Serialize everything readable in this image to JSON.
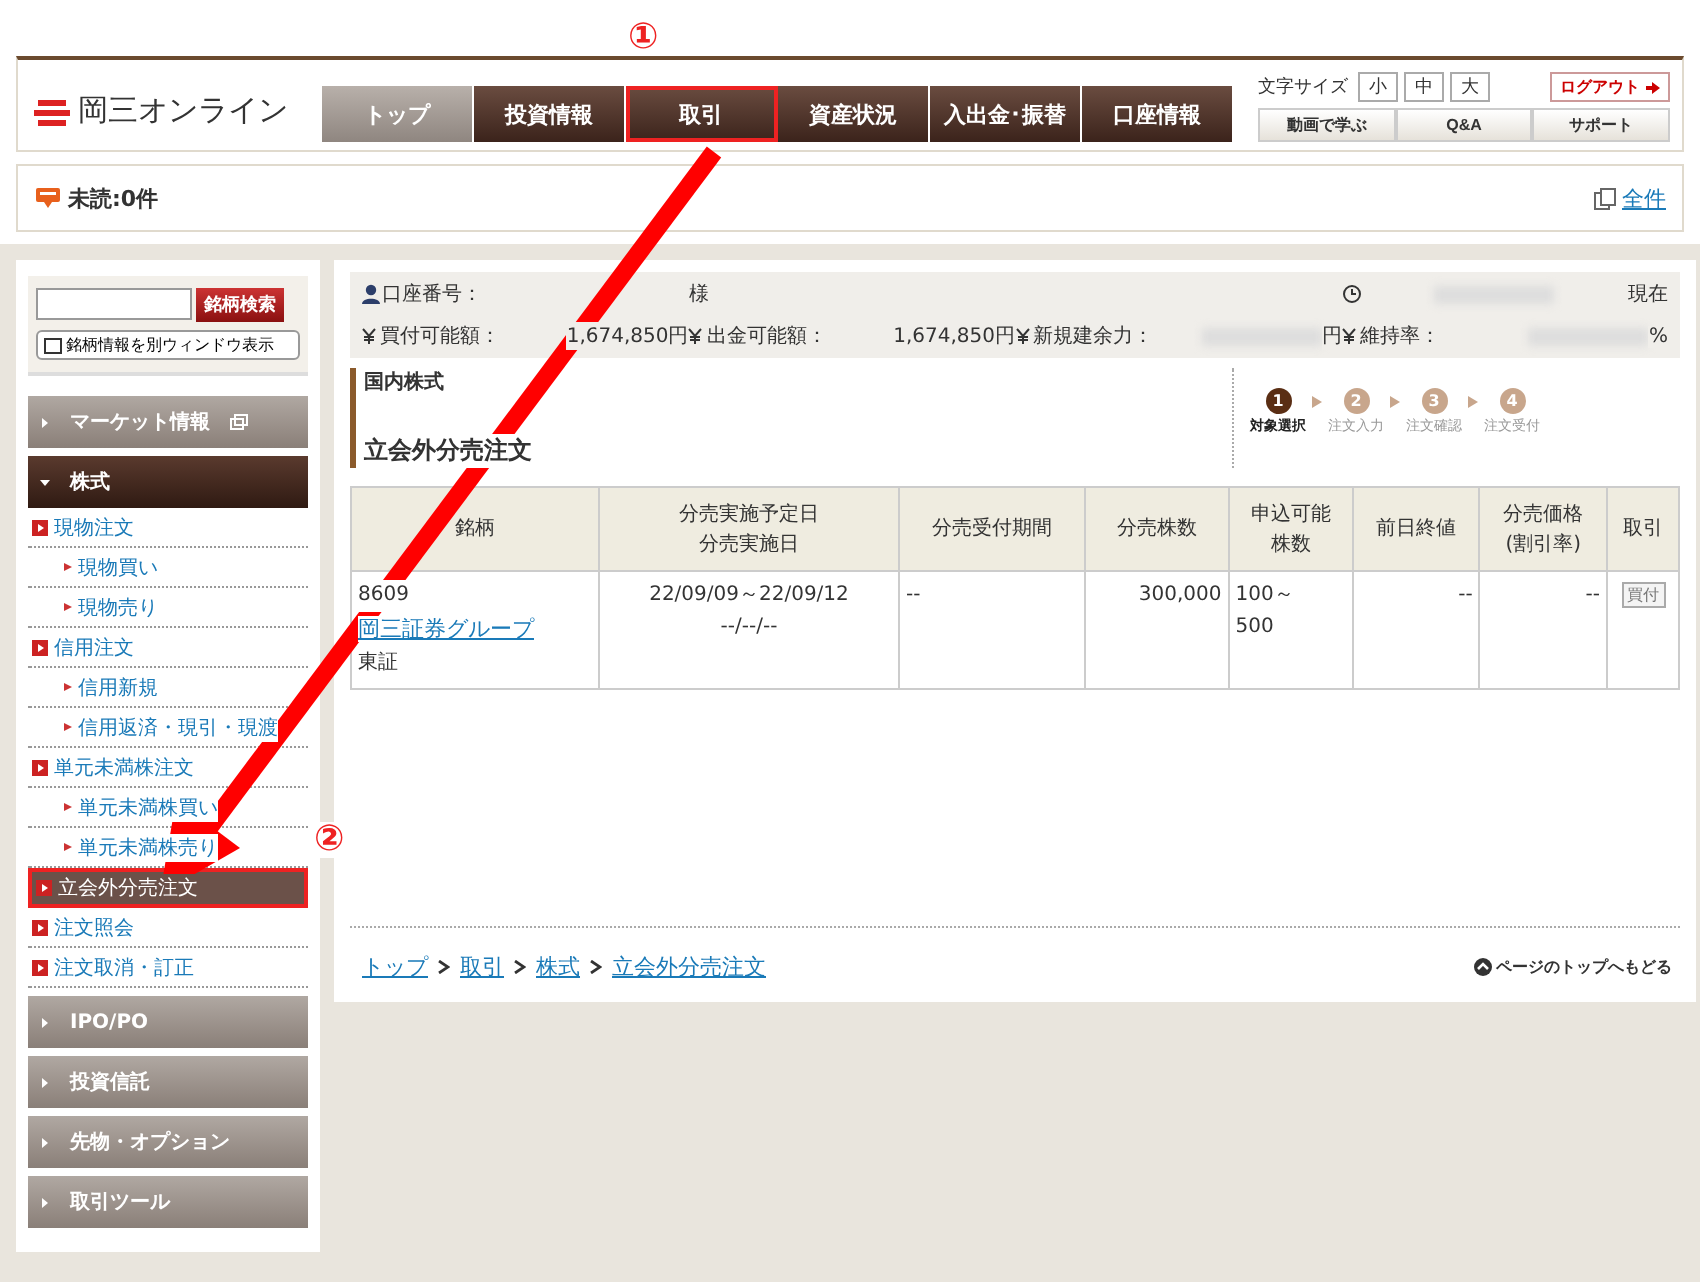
{
  "annotations": [
    {
      "label": "①"
    },
    {
      "label": "②"
    }
  ],
  "header": {
    "logo": "岡三オンライン",
    "nav": [
      {
        "label": "トップ",
        "kind": "home",
        "highlighted": false
      },
      {
        "label": "投資情報",
        "kind": "section",
        "highlighted": false
      },
      {
        "label": "取引",
        "kind": "section",
        "highlighted": true
      },
      {
        "label": "資産状況",
        "kind": "section",
        "highlighted": false
      },
      {
        "label": "入出金･振替",
        "kind": "section",
        "highlighted": false
      },
      {
        "label": "口座情報",
        "kind": "section",
        "highlighted": false
      }
    ],
    "font_size": {
      "label": "文字サイズ",
      "options": [
        {
          "label": "小",
          "selected": false
        },
        {
          "label": "中",
          "selected": false
        },
        {
          "label": "大",
          "selected": false
        }
      ]
    },
    "logout": "ログアウト",
    "links": [
      "動画で学ぶ",
      "Q&A",
      "サポート"
    ]
  },
  "notice": {
    "unread": "未読:0件",
    "all": "全件"
  },
  "sidebar": {
    "search_button": "銘柄検索",
    "window_button": "銘柄情報を別ウィンドウ表示",
    "sections": [
      {
        "label": "マーケット情報",
        "expanded": false,
        "external": true
      },
      {
        "label": "株式",
        "expanded": true,
        "children": [
          {
            "label": "現物注文",
            "selected": false,
            "children": [
              {
                "label": "現物買い",
                "selected": false
              },
              {
                "label": "現物売り",
                "selected": false
              }
            ]
          },
          {
            "label": "信用注文",
            "selected": false,
            "children": [
              {
                "label": "信用新規",
                "selected": false
              },
              {
                "label": "信用返済・現引・現渡",
                "selected": false
              }
            ]
          },
          {
            "label": "単元未満株注文",
            "selected": false,
            "children": [
              {
                "label": "単元未満株買い",
                "selected": false
              },
              {
                "label": "単元未満株売り",
                "selected": false
              }
            ]
          },
          {
            "label": "立会外分売注文",
            "selected": true
          },
          {
            "label": "注文照会",
            "selected": false
          },
          {
            "label": "注文取消・訂正",
            "selected": false
          }
        ]
      },
      {
        "label": "IPO/PO",
        "expanded": false
      },
      {
        "label": "投資信託",
        "expanded": false
      },
      {
        "label": "先物・オプション",
        "expanded": false
      },
      {
        "label": "取引ツール",
        "expanded": false
      }
    ]
  },
  "account": {
    "number_label": "口座番号：",
    "honorific": "様",
    "as_of": "現在",
    "balances": [
      {
        "label": "買付可能額：",
        "value": "1,674,850円",
        "masked": false
      },
      {
        "label": "出金可能額：",
        "value": "1,674,850円",
        "masked": false
      },
      {
        "label": "新規建余力：",
        "value": "円",
        "masked": true
      },
      {
        "label": "維持率：",
        "value": "%",
        "masked": true
      }
    ]
  },
  "main": {
    "category": "国内株式",
    "title": "立会外分売注文",
    "steps": [
      {
        "number": "1",
        "label": "対象選択",
        "selected": true
      },
      {
        "number": "2",
        "label": "注文入力",
        "selected": false
      },
      {
        "number": "3",
        "label": "注文確認",
        "selected": false
      },
      {
        "number": "4",
        "label": "注文受付",
        "selected": false
      }
    ],
    "table": {
      "columns": [
        [
          "銘柄"
        ],
        [
          "分売実施予定日",
          "分売実施日"
        ],
        [
          "分売受付期間"
        ],
        [
          "分売株数"
        ],
        [
          "申込可能",
          "株数"
        ],
        [
          "前日終値"
        ],
        [
          "分売価格",
          "(割引率)"
        ],
        [
          "取引"
        ]
      ],
      "rows": [
        {
          "code": "8609",
          "name": "岡三証券グループ",
          "market": "東証",
          "dates": [
            "22/09/09～22/09/12",
            "--/--/--"
          ],
          "period": "--",
          "shares": "300,000",
          "available": [
            "100～",
            "500"
          ],
          "prev_close": "--",
          "price": "--",
          "action": "買付"
        }
      ]
    },
    "breadcrumb": [
      "トップ",
      "取引",
      "株式",
      "立会外分売注文"
    ],
    "back_to_top": "ページのトップへもどる"
  }
}
